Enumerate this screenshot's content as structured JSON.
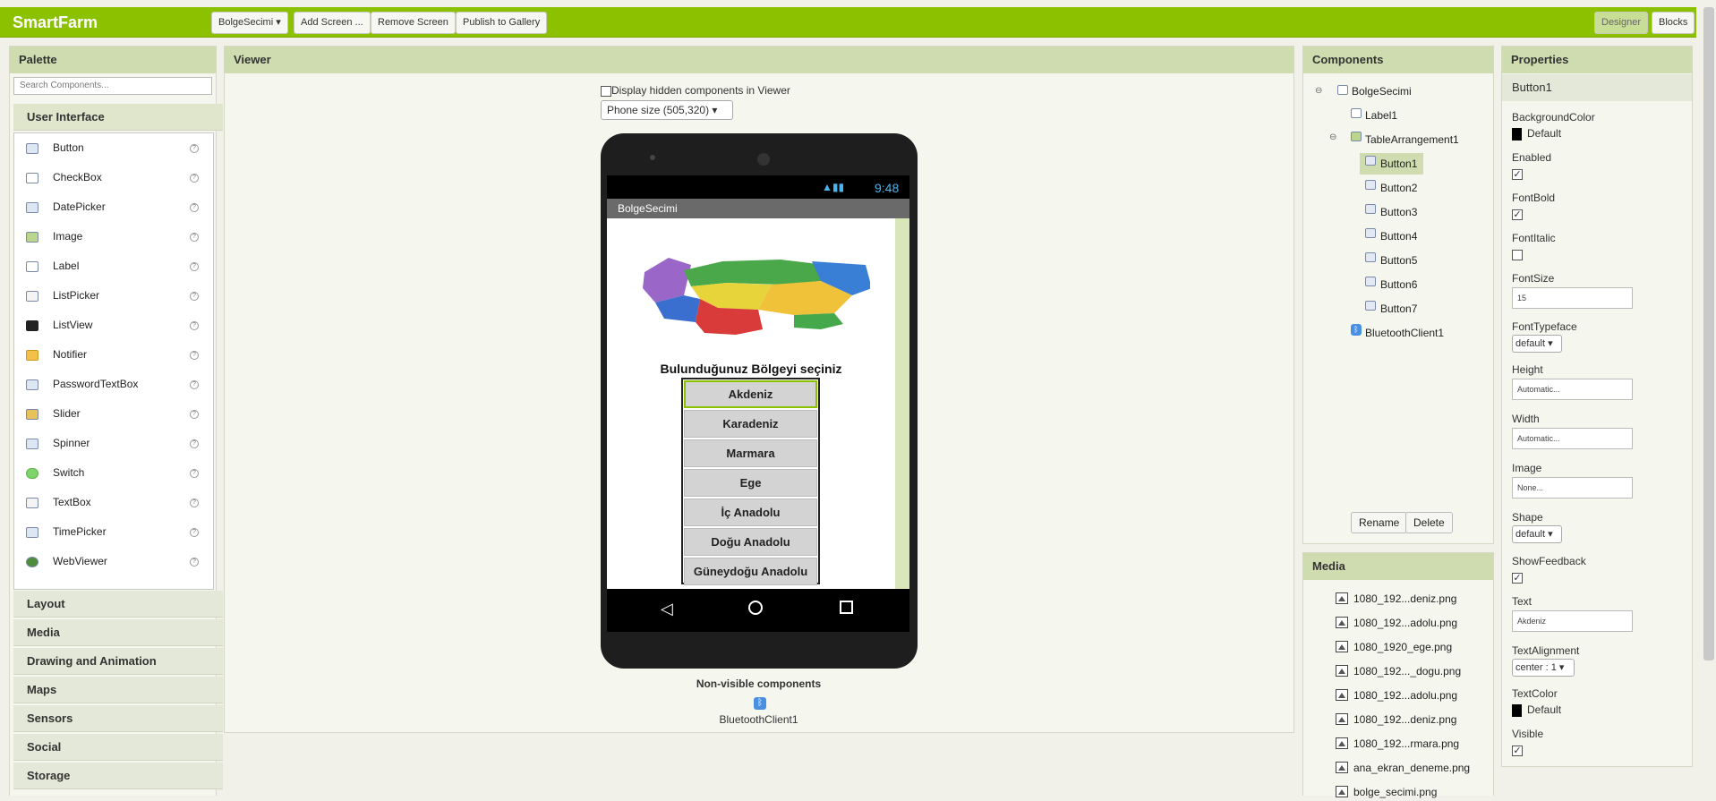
{
  "app": {
    "title": "SmartFarm"
  },
  "toolbar": {
    "screen_select": "BolgeSecimi ▾",
    "add_screen": "Add Screen ...",
    "remove_screen": "Remove Screen",
    "publish": "Publish to Gallery",
    "designer": "Designer",
    "blocks": "Blocks"
  },
  "palette": {
    "title": "Palette",
    "search_placeholder": "Search Components...",
    "user_interface": "User Interface",
    "items": [
      "Button",
      "CheckBox",
      "DatePicker",
      "Image",
      "Label",
      "ListPicker",
      "ListView",
      "Notifier",
      "PasswordTextBox",
      "Slider",
      "Spinner",
      "Switch",
      "TextBox",
      "TimePicker",
      "WebViewer"
    ],
    "help": "?",
    "categories": [
      "Layout",
      "Media",
      "Drawing and Animation",
      "Maps",
      "Sensors",
      "Social",
      "Storage"
    ]
  },
  "viewer": {
    "title": "Viewer",
    "hidden_label": "Display hidden components in Viewer",
    "size_select": "Phone size (505,320) ▾",
    "status_time": "9:48",
    "screen_title": "BolgeSecimi",
    "label_text": "Bulunduğunuz Bölgeyi seçiniz",
    "buttons": [
      "Akdeniz",
      "Karadeniz",
      "Marmara",
      "Ege",
      "İç Anadolu",
      "Doğu Anadolu",
      "Güneydoğu Anadolu"
    ],
    "nonvisible_title": "Non-visible components",
    "nonvisible_item": "BluetoothClient1"
  },
  "components": {
    "title": "Components",
    "tree": {
      "screen": "BolgeSecimi",
      "label": "Label1",
      "table": "TableArrangement1",
      "buttons": [
        "Button1",
        "Button2",
        "Button3",
        "Button4",
        "Button5",
        "Button6",
        "Button7"
      ],
      "bluetooth": "BluetoothClient1"
    },
    "rename": "Rename",
    "delete": "Delete"
  },
  "media": {
    "title": "Media",
    "files": [
      "1080_192...deniz.png",
      "1080_192...adolu.png",
      "1080_1920_ege.png",
      "1080_192..._dogu.png",
      "1080_192...adolu.png",
      "1080_192...deniz.png",
      "1080_192...rmara.png",
      "ana_ekran_deneme.png",
      "bolge_secimi.png"
    ]
  },
  "properties": {
    "title": "Properties",
    "component": "Button1",
    "background_color_label": "BackgroundColor",
    "background_color_value": "Default",
    "enabled_label": "Enabled",
    "fontbold_label": "FontBold",
    "fontitalic_label": "FontItalic",
    "fontsize_label": "FontSize",
    "fontsize_value": "15",
    "fonttypeface_label": "FontTypeface",
    "fonttypeface_value": "default ▾",
    "height_label": "Height",
    "height_value": "Automatic...",
    "width_label": "Width",
    "width_value": "Automatic...",
    "image_label": "Image",
    "image_value": "None...",
    "shape_label": "Shape",
    "shape_value": "default ▾",
    "showfeedback_label": "ShowFeedback",
    "text_label": "Text",
    "text_value": "Akdeniz",
    "textalign_label": "TextAlignment",
    "textalign_value": "center : 1 ▾",
    "textcolor_label": "TextColor",
    "textcolor_value": "Default",
    "visible_label": "Visible",
    "check": "✓"
  },
  "colors": {
    "accent": "#8cc100",
    "panel_header": "#cfdcb0"
  }
}
